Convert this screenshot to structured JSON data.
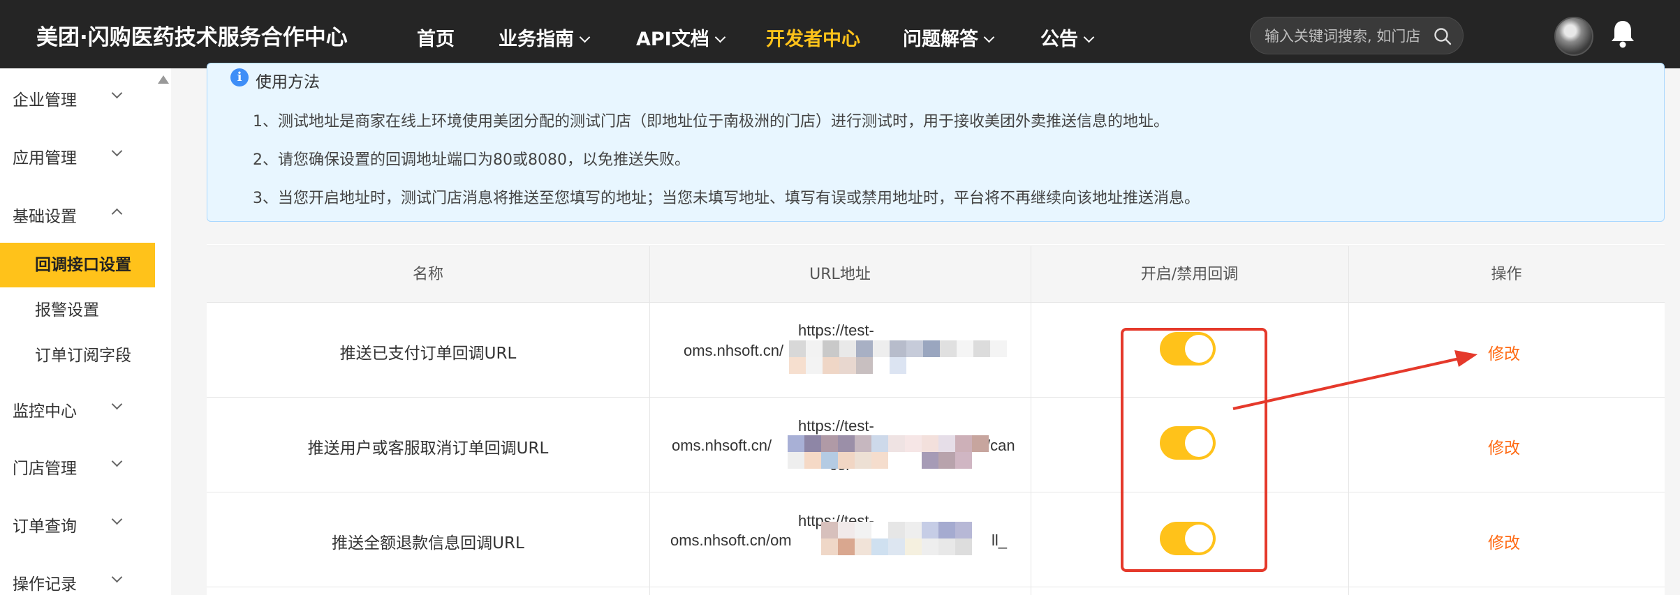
{
  "header": {
    "brand": "美团·闪购医药技术服务合作中心",
    "nav": [
      {
        "label": "首页",
        "dropdown": false,
        "active": false
      },
      {
        "label": "业务指南",
        "dropdown": true,
        "active": false
      },
      {
        "label": "API文档",
        "dropdown": true,
        "active": false
      },
      {
        "label": "开发者中心",
        "dropdown": false,
        "active": true
      },
      {
        "label": "问题解答",
        "dropdown": true,
        "active": false
      },
      {
        "label": "公告",
        "dropdown": true,
        "active": false
      }
    ],
    "search_placeholder": "输入关键词搜索, 如门店",
    "icons": {
      "search": "search-icon",
      "bell": "bell-icon",
      "avatar": "user-avatar"
    }
  },
  "sidebar": {
    "menu": [
      {
        "label": "企业管理",
        "expanded": false
      },
      {
        "label": "应用管理",
        "expanded": false
      },
      {
        "label": "基础设置",
        "expanded": true
      },
      {
        "label": "监控中心",
        "expanded": false
      },
      {
        "label": "门店管理",
        "expanded": false
      },
      {
        "label": "订单查询",
        "expanded": false
      },
      {
        "label": "操作记录",
        "expanded": false
      }
    ],
    "sub_items": [
      {
        "label": "回调接口设置",
        "active": true
      },
      {
        "label": "报警设置",
        "active": false
      },
      {
        "label": "订单订阅字段",
        "active": false
      }
    ]
  },
  "info": {
    "title": "使用方法",
    "lines": [
      "1、测试地址是商家在线上环境使用美团分配的测试门店（即地址位于南极洲的门店）进行测试时，用于接收美团外卖推送信息的地址。",
      "2、请您确保设置的回调地址端口为80或8080，以免推送失败。",
      "3、当您开启地址时，测试门店消息将推送至您填写的地址；当您未填写地址、填写有误或禁用地址时，平台将不再继续向该地址推送消息。"
    ]
  },
  "table": {
    "headers": [
      "名称",
      "URL地址",
      "开启/禁用回调",
      "操作"
    ],
    "rows": [
      {
        "name": "推送已支付订单回调URL",
        "url_top": "https://test-",
        "url_mid": "oms.nhsoft.cn/",
        "url_tail": "",
        "url_bottom": "",
        "enabled": true,
        "action": "修改"
      },
      {
        "name": "推送用户或客服取消订单回调URL",
        "url_top": "https://test-",
        "url_mid": "oms.nhsoft.cn/",
        "url_tail": "/can",
        "url_bottom": "cel",
        "enabled": true,
        "action": "修改"
      },
      {
        "name": "推送全额退款信息回调URL",
        "url_top": "https://test-",
        "url_mid": "oms.nhsoft.cn/om",
        "url_tail": "ll_",
        "url_bottom": "",
        "enabled": true,
        "action": "修改"
      }
    ]
  },
  "colors": {
    "accent": "#ffc21a",
    "action": "#ff6a13",
    "annotation": "#e5392b",
    "info_bg": "#e8f6ff"
  }
}
